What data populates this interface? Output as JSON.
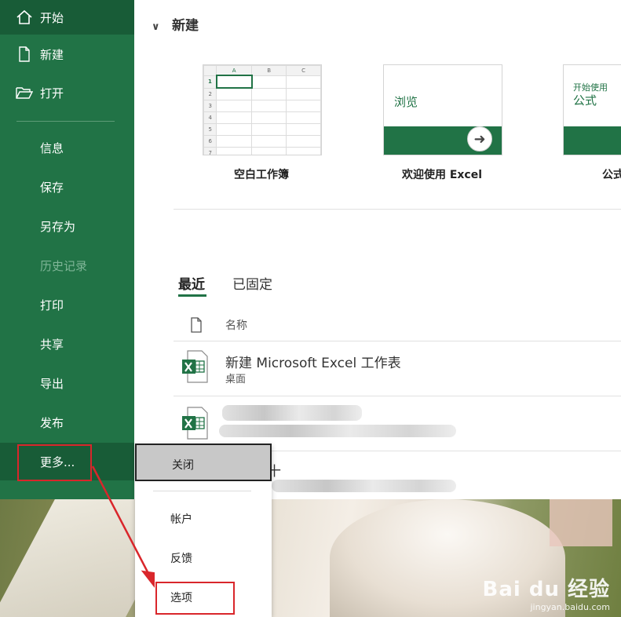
{
  "sidebar": {
    "items": [
      {
        "label": "开始",
        "icon": "home-icon"
      },
      {
        "label": "新建",
        "icon": "new-document-icon"
      },
      {
        "label": "打开",
        "icon": "open-folder-icon"
      },
      {
        "label": "信息"
      },
      {
        "label": "保存"
      },
      {
        "label": "另存为"
      },
      {
        "label": "历史记录",
        "disabled": true
      },
      {
        "label": "打印"
      },
      {
        "label": "共享"
      },
      {
        "label": "导出"
      },
      {
        "label": "发布"
      },
      {
        "label": "更多..."
      }
    ]
  },
  "new_section": {
    "heading": "新建",
    "templates": [
      {
        "caption": "空白工作簿",
        "columns": [
          "A",
          "B",
          "C"
        ],
        "rows": [
          "1",
          "2",
          "3",
          "4",
          "5",
          "6",
          "7"
        ]
      },
      {
        "caption": "欢迎使用 Excel",
        "title": "浏览"
      },
      {
        "caption": "公式",
        "subtitle": "开始使用",
        "title": "公式"
      }
    ]
  },
  "recent": {
    "tabs": [
      "最近",
      "已固定"
    ],
    "column_name": "名称",
    "files": [
      {
        "name": "新建 Microsoft Excel 工作表",
        "path": "桌面"
      },
      {
        "name": "",
        "path": ""
      },
      {
        "name": "十",
        "path": ""
      }
    ]
  },
  "more_menu": {
    "items": [
      "关闭",
      "帐户",
      "反馈",
      "选项"
    ]
  },
  "watermark": {
    "brand": "Bai du 经验",
    "url": "jingyan.baidu.com"
  },
  "colors": {
    "excel_green": "#217346",
    "excel_green_dark": "#185c37",
    "highlight_red": "#d9262b"
  }
}
